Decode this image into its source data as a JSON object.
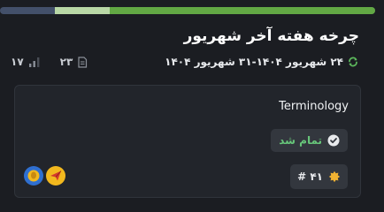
{
  "progress": {
    "segments": [
      {
        "name": "light",
        "fraction": 0.143,
        "color": "#b9d8a6"
      },
      {
        "name": "completed",
        "fraction": 0.692,
        "color": "#62a844"
      }
    ],
    "track_color": "#43506a"
  },
  "cycle": {
    "title": "چرخه هفته آخر شهریور",
    "date_range": "۲۴ شهریور ۱۴۰۴-۳۱ شهریور ۱۴۰۴",
    "icon": "cycle-icon"
  },
  "stats": {
    "issues_count": "۲۳",
    "issues_icon": "document-icon",
    "estimate_count": "۱۷",
    "estimate_icon": "signal-bars-icon"
  },
  "card": {
    "title": "Terminology",
    "status": {
      "label": "تمام شد",
      "icon": "check-circle-icon",
      "color": "#67c67a"
    },
    "points": {
      "label": "# ۴۱",
      "icon": "star-icon",
      "color": "#f0b232"
    },
    "avatars": [
      {
        "name": "avatar-one",
        "icon": "head-icon",
        "color": "#2f6fd0"
      },
      {
        "name": "avatar-two",
        "icon": "paper-plane-icon",
        "color": "#f2b81e"
      }
    ]
  },
  "colors": {
    "background": "#1b1d22",
    "card": "#22252b",
    "accent_green": "#62a844"
  }
}
